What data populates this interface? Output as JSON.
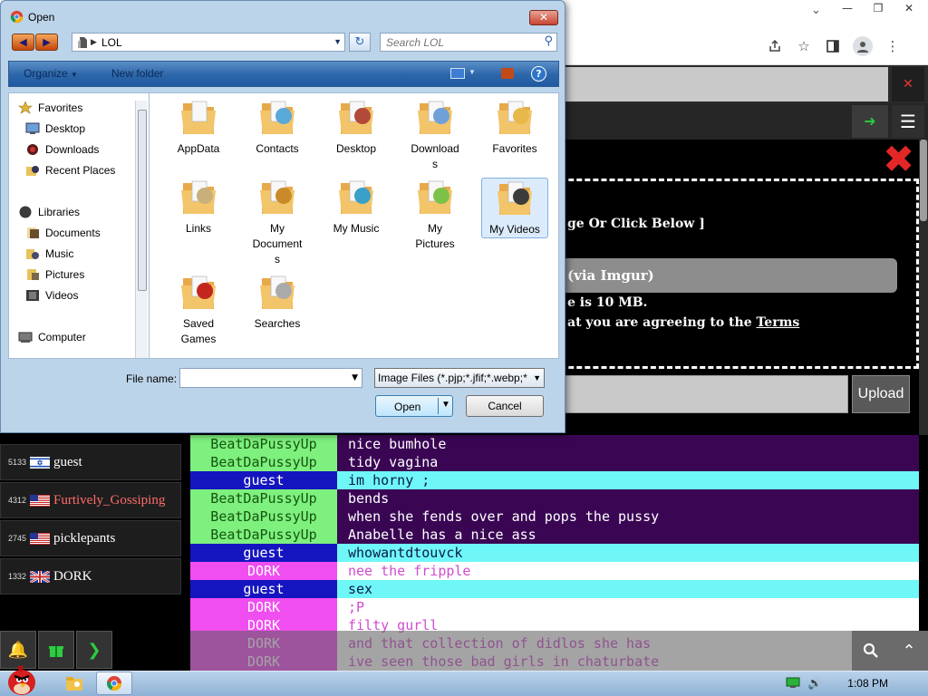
{
  "dialog": {
    "title": "Open",
    "address": "LOL",
    "search_placeholder": "Search LOL",
    "commands": {
      "organize": "Organize",
      "new_folder": "New folder"
    },
    "nav_items": [
      {
        "label": "Favorites",
        "icon": "star-icon"
      },
      {
        "label": "Desktop",
        "icon": "desktop-icon"
      },
      {
        "label": "Downloads",
        "icon": "downloads-icon"
      },
      {
        "label": "Recent Places",
        "icon": "recent-places-icon"
      },
      {
        "label": "Libraries",
        "icon": "libraries-icon"
      },
      {
        "label": "Documents",
        "icon": "documents-icon"
      },
      {
        "label": "Music",
        "icon": "music-icon"
      },
      {
        "label": "Pictures",
        "icon": "pictures-icon"
      },
      {
        "label": "Videos",
        "icon": "videos-icon"
      },
      {
        "label": "Computer",
        "icon": "computer-icon"
      }
    ],
    "files": [
      {
        "line1": "AppData",
        "line2": "",
        "line3": ""
      },
      {
        "line1": "Contacts",
        "line2": "",
        "line3": ""
      },
      {
        "line1": "Desktop",
        "line2": "",
        "line3": ""
      },
      {
        "line1": "Download",
        "line2": "s",
        "line3": ""
      },
      {
        "line1": "Favorites",
        "line2": "",
        "line3": ""
      },
      {
        "line1": "Links",
        "line2": "",
        "line3": ""
      },
      {
        "line1": "My",
        "line2": "Document",
        "line3": "s"
      },
      {
        "line1": "My Music",
        "line2": "",
        "line3": ""
      },
      {
        "line1": "My",
        "line2": "Pictures",
        "line3": ""
      },
      {
        "line1": "My Videos",
        "line2": "",
        "line3": ""
      },
      {
        "line1": "Saved",
        "line2": "Games",
        "line3": ""
      },
      {
        "line1": "Searches",
        "line2": "",
        "line3": ""
      }
    ],
    "file_name_label": "File name:",
    "file_name_value": "",
    "file_type": "Image Files (*.pjp;*.jfif;*.webp;*",
    "open_label": "Open",
    "cancel_label": "Cancel"
  },
  "site": {
    "upload_text_1": "ge Or Click Below ]",
    "upload_text_2": "(via Imgur)",
    "upload_text_3": "e is 10 MB.",
    "upload_text_4": "at you are agreeing to the ",
    "terms_link": "Terms",
    "upload_button": "Upload"
  },
  "users": [
    {
      "count": "5133",
      "name": "guest",
      "flag": "israel",
      "name_color": "#ffffff"
    },
    {
      "count": "4312",
      "name": "Furtively_Gossiping",
      "flag": "usa",
      "name_color": "#ff6b6b"
    },
    {
      "count": "2745",
      "name": "picklepants",
      "flag": "usa",
      "name_color": "#ffffff"
    },
    {
      "count": "1332",
      "name": "DORK",
      "flag": "uk",
      "name_color": "#ffffff"
    }
  ],
  "messages": [
    {
      "name": "BeatDaPussyUp",
      "text": "nice bumhole",
      "nbg": "#7ef07e",
      "nfg": "#14550f",
      "tbg": "#3a0654",
      "tfg": "#ffffff"
    },
    {
      "name": "BeatDaPussyUp",
      "text": "tidy vagina",
      "nbg": "#7ef07e",
      "nfg": "#14550f",
      "tbg": "#3a0654",
      "tfg": "#ffffff"
    },
    {
      "name": "guest",
      "text": "im horny ;",
      "nbg": "#1515c0",
      "nfg": "#ffffff",
      "tbg": "#6ff7f7",
      "tfg": "#0a1a4a"
    },
    {
      "name": "BeatDaPussyUp",
      "text": "bends",
      "nbg": "#7ef07e",
      "nfg": "#14550f",
      "tbg": "#3a0654",
      "tfg": "#ffffff"
    },
    {
      "name": "BeatDaPussyUp",
      "text": "when she fends over and pops the pussy",
      "nbg": "#7ef07e",
      "nfg": "#14550f",
      "tbg": "#3a0654",
      "tfg": "#ffffff"
    },
    {
      "name": "BeatDaPussyUp",
      "text": "Anabelle has a nice ass",
      "nbg": "#7ef07e",
      "nfg": "#14550f",
      "tbg": "#3a0654",
      "tfg": "#ffffff"
    },
    {
      "name": "guest",
      "text": "whowantdtouvck",
      "nbg": "#1515c0",
      "nfg": "#ffffff",
      "tbg": "#6ff7f7",
      "tfg": "#0a1a4a"
    },
    {
      "name": "DORK",
      "text": "nee the fripple",
      "nbg": "#f04ef0",
      "nfg": "#ffffff",
      "tbg": "#ffffff",
      "tfg": "#d04cd0"
    },
    {
      "name": "guest",
      "text": "sex",
      "nbg": "#1515c0",
      "nfg": "#ffffff",
      "tbg": "#6ff7f7",
      "tfg": "#0a1a4a"
    },
    {
      "name": "DORK",
      "text": ";P",
      "nbg": "#f04ef0",
      "nfg": "#ffffff",
      "tbg": "#ffffff",
      "tfg": "#d04cd0"
    },
    {
      "name": "DORK",
      "text": "filty gurll",
      "nbg": "#f04ef0",
      "nfg": "#ffffff",
      "tbg": "#ffffff",
      "tfg": "#d04cd0"
    },
    {
      "name": "DORK",
      "text": "and that collection of didlos she has",
      "nbg": "#f04ef0",
      "nfg": "#ffffff",
      "tbg": "#ffffff",
      "tfg": "#d04cd0"
    },
    {
      "name": "DORK",
      "text": "ive seen those bad girls in chaturbate",
      "nbg": "#f04ef0",
      "nfg": "#ffffff",
      "tbg": "#ffffff",
      "tfg": "#d04cd0"
    }
  ],
  "taskbar": {
    "clock": "1:08 PM"
  }
}
